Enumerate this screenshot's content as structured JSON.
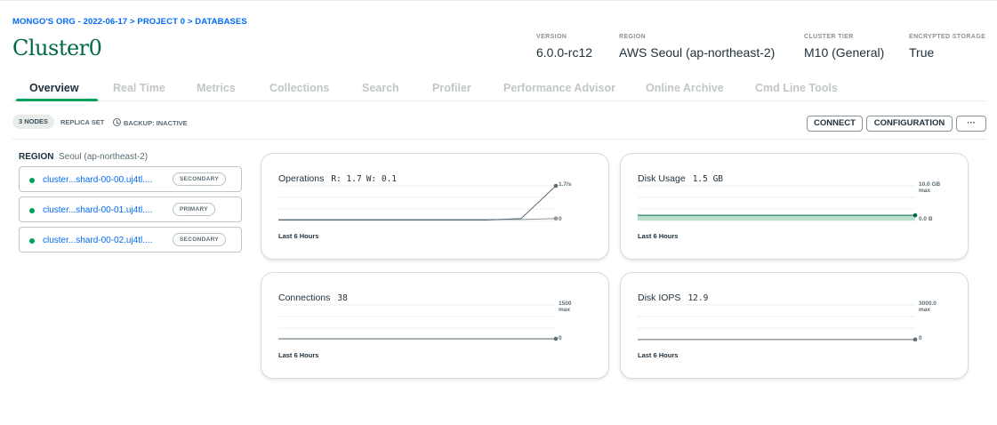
{
  "breadcrumb": {
    "org": "MONGO'S ORG - 2022-06-17",
    "sep1": " > ",
    "project": "PROJECT 0",
    "sep2": " > ",
    "page": "DATABASES"
  },
  "cluster": {
    "name": "Cluster0",
    "meta": [
      {
        "label": "VERSION",
        "value": "6.0.0-rc12"
      },
      {
        "label": "REGION",
        "value": "AWS Seoul (ap-northeast-2)"
      },
      {
        "label": "CLUSTER TIER",
        "value": "M10 (General)"
      },
      {
        "label": "ENCRYPTED STORAGE",
        "value": "True"
      }
    ]
  },
  "tabs": [
    "Overview",
    "Real Time",
    "Metrics",
    "Collections",
    "Search",
    "Profiler",
    "Performance Advisor",
    "Online Archive",
    "Cmd Line Tools"
  ],
  "active_tab": 0,
  "subheader": {
    "nodes_pill": "3 NODES",
    "replica_set": "REPLICA SET",
    "backup": "BACKUP: INACTIVE",
    "connect": "CONNECT",
    "configuration": "CONFIGURATION",
    "more": "···"
  },
  "region": {
    "label": "REGION",
    "value": "Seoul (ap-northeast-2)"
  },
  "nodes": [
    {
      "name": "cluster...shard-00-00.uj4tl....",
      "role": "SECONDARY"
    },
    {
      "name": "cluster...shard-00-01.uj4tl....",
      "role": "PRIMARY"
    },
    {
      "name": "cluster...shard-00-02.uj4tl....",
      "role": "SECONDARY"
    }
  ],
  "colors": {
    "accent_green": "#00a35c",
    "brand_green": "#00684a",
    "link_blue": "#016bf8",
    "line_gray": "#5c6c75"
  },
  "metrics": {
    "operations": {
      "title": "Operations",
      "r_label": "R: 1.7",
      "w_label": "W: 0.1",
      "max_label": "1.7/s",
      "min_label": "0",
      "footer": "Last 6 Hours",
      "max_value": 1.7,
      "series_r": [
        0.02,
        0.02,
        0.02,
        0.02,
        0.02,
        0.02,
        0.02,
        0.1,
        1.7
      ],
      "series_w": [
        0.05,
        0.05,
        0.05,
        0.05,
        0.05,
        0.05,
        0.05,
        0.05,
        0.1
      ]
    },
    "disk_usage": {
      "title": "Disk Usage",
      "value": "1.5 GB",
      "max_label": "10.0 GB",
      "max_suffix": "max",
      "min_label": "0.0 B",
      "footer": "Last 6 Hours",
      "max_value": 10.0,
      "series": [
        1.5,
        1.5,
        1.5,
        1.5,
        1.5,
        1.5,
        1.5,
        1.5,
        1.5
      ]
    },
    "connections": {
      "title": "Connections",
      "value": "38",
      "max_label": "1500",
      "max_suffix": "max",
      "min_label": "0",
      "footer": "Last 6 Hours",
      "max_value": 1500,
      "series": [
        38,
        38,
        38,
        38,
        38,
        38,
        38,
        38,
        38
      ]
    },
    "disk_iops": {
      "title": "Disk IOPS",
      "value": "12.9",
      "max_label": "3000.0",
      "max_suffix": "max",
      "min_label": "0",
      "footer": "Last 6 Hours",
      "max_value": 3000,
      "series": [
        8,
        9,
        10,
        10,
        11,
        11,
        12,
        12,
        12.9
      ]
    }
  }
}
